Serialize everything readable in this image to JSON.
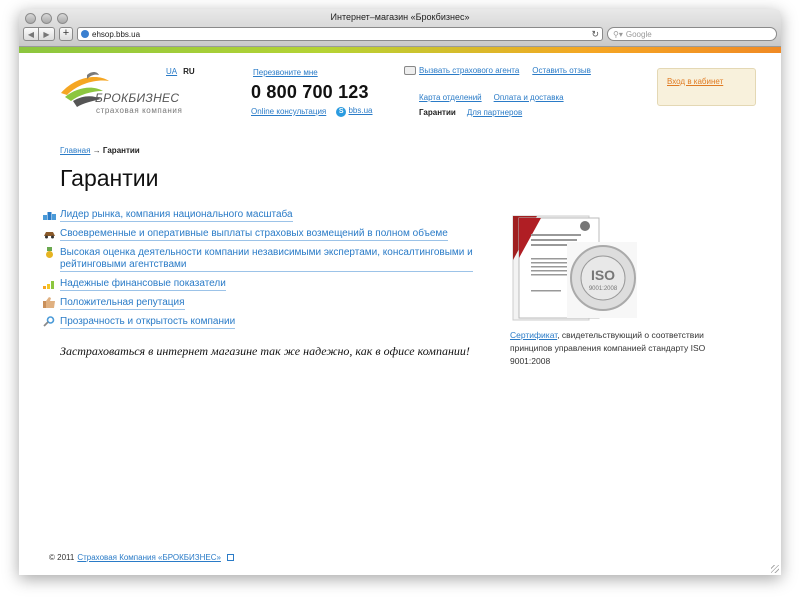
{
  "window": {
    "title": "Интернет–магазин «Брокбизнес»"
  },
  "browser": {
    "url": "ehsop.bbs.ua",
    "search_placeholder": "Google",
    "reload_icon": "reload-icon"
  },
  "header": {
    "logo_name": "БРОКБИЗНЕС",
    "logo_sub": "страховая компания",
    "lang": [
      "UA",
      "RU"
    ],
    "callback": "Перезвоните мне",
    "phone": "0 800 700 123",
    "online": "Online консультация",
    "skype": "bbs.ua",
    "nav_top": [
      "Вызвать страхового агента",
      "Оставить отзыв"
    ],
    "nav_mid": [
      "Карта отделений",
      "Оплата и доставка"
    ],
    "nav_bottom": [
      "Гарантии",
      "Для партнеров"
    ],
    "login": "Вход в кабинет"
  },
  "breadcrumb": {
    "home": "Главная",
    "sep": "→",
    "current": "Гарантии"
  },
  "page_title": "Гарантии",
  "features": [
    {
      "icon": "podium-icon",
      "text": "Лидер рынка, компания национального масштаба"
    },
    {
      "icon": "car-icon",
      "text": "Своевременные и оперативные выплаты страховых возмещений в полном объеме"
    },
    {
      "icon": "medal-icon",
      "text": "Высокая оценка деятельности компании независимыми экспертами, консалтинговыми и рейтинговыми агентствами"
    },
    {
      "icon": "chart-bars-icon",
      "text": "Надежные финансовые показатели"
    },
    {
      "icon": "thumbs-up-icon",
      "text": "Положительная репутация"
    },
    {
      "icon": "magnifier-icon",
      "text": "Прозрачность и открытость компании"
    }
  ],
  "slogan": "Застраховаться в интернет магазине так же надежно, как в офисе компании!",
  "certificate": {
    "link": "Сертификат",
    "text": ", свидетельствующий о соответствии принципов управления компанией стандарту ISO 9001:2008",
    "seal": "ISO",
    "seal_sub": "9001:2008"
  },
  "footer": {
    "copyright": "© 2011",
    "link": "Страховая Компания «БРОКБИЗНЕС»"
  },
  "colors": {
    "link": "#2a7bc7",
    "login_bg": "#f8f1dc",
    "login_link": "#e07b22"
  }
}
